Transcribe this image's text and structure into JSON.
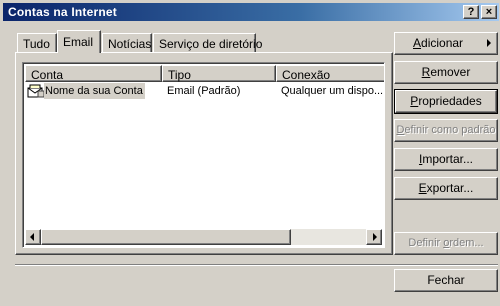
{
  "window": {
    "title": "Contas na Internet",
    "help_button": "?",
    "close_button": "×"
  },
  "tabs": [
    {
      "label": "Tudo",
      "active": false
    },
    {
      "label": "Email",
      "active": true
    },
    {
      "label": "Notícias",
      "active": false
    },
    {
      "label": "Serviço de diretório",
      "active": false
    }
  ],
  "list": {
    "columns": [
      "Conta",
      "Tipo",
      "Conexão"
    ],
    "rows": [
      {
        "conta": "Nome da sua Conta",
        "tipo": "Email (Padrão)",
        "conexao": "Qualquer um dispo...",
        "icon": "mail-account-icon",
        "selected": true
      }
    ]
  },
  "buttons": {
    "adicionar": {
      "pre": "",
      "accel": "A",
      "post": "dicionar"
    },
    "remover": {
      "pre": "",
      "accel": "R",
      "post": "emover"
    },
    "propriedades": {
      "pre": "",
      "accel": "P",
      "post": "ropriedades"
    },
    "definir_padrao": {
      "pre": "",
      "accel": "D",
      "post": "efinir como padrão"
    },
    "importar": {
      "pre": "",
      "accel": "I",
      "post": "mportar..."
    },
    "exportar": {
      "pre": "",
      "accel": "E",
      "post": "xportar..."
    },
    "definir_ordem": {
      "pre": "Definir ",
      "accel": "o",
      "post": "rdem..."
    },
    "fechar": "Fechar"
  }
}
